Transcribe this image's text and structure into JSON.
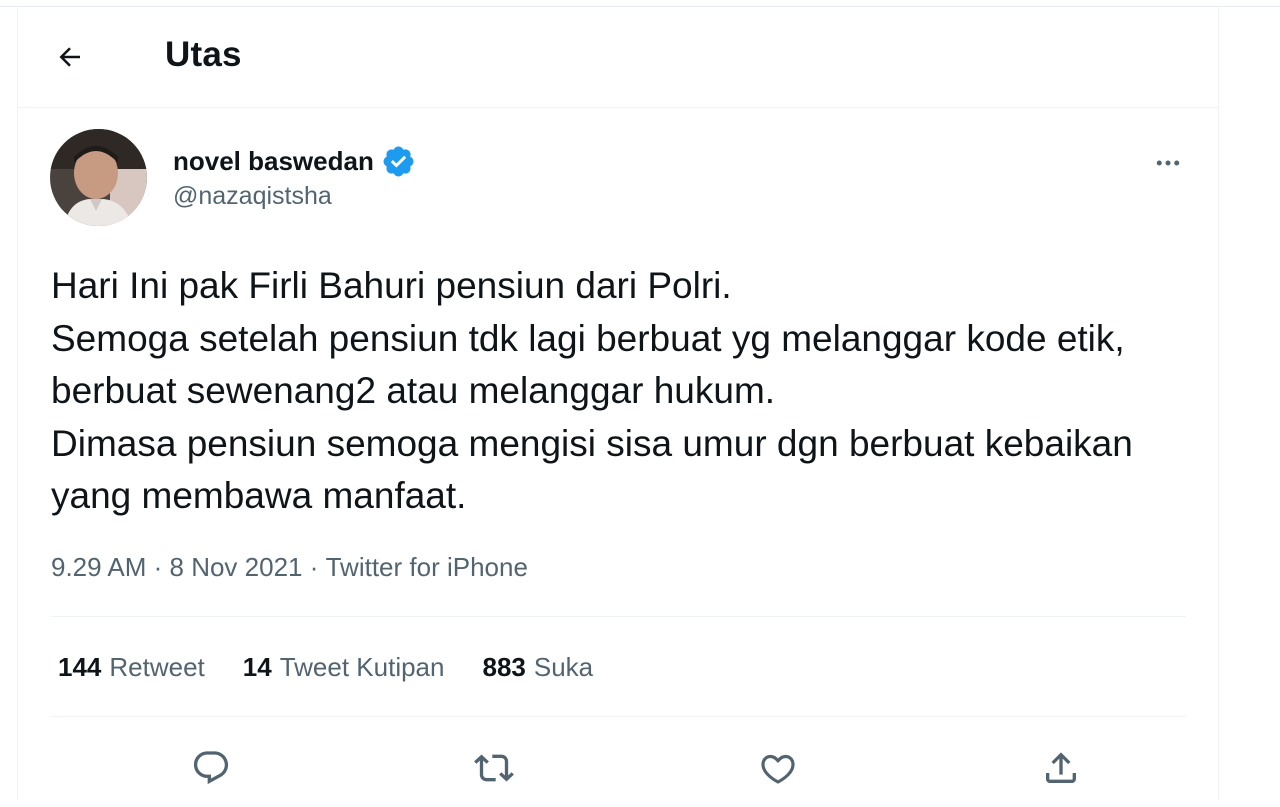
{
  "header": {
    "title": "Utas"
  },
  "tweet": {
    "author_name": "novel baswedan",
    "author_handle": "@nazaqistsha",
    "text": "Hari Ini pak Firli Bahuri pensiun dari Polri.\nSemoga setelah pensiun tdk lagi berbuat yg melanggar kode etik, berbuat sewenang2 atau melanggar hukum.\nDimasa pensiun semoga mengisi sisa umur dgn berbuat kebaikan yang membawa manfaat.",
    "time": "9.29 AM",
    "date": "8 Nov 2021",
    "separator": " · ",
    "source": "Twitter for iPhone"
  },
  "stats": {
    "retweets_count": "144",
    "retweets_label": "Retweet",
    "quotes_count": "14",
    "quotes_label": "Tweet Kutipan",
    "likes_count": "883",
    "likes_label": "Suka"
  },
  "icons": {
    "back": "arrow-left-icon",
    "verified": "verified-badge-icon",
    "more": "more-horizontal-icon",
    "reply": "reply-icon",
    "retweet": "retweet-icon",
    "like": "heart-icon",
    "share": "share-icon"
  },
  "colors": {
    "verified": "#1d9bf0",
    "secondary_text": "#536471",
    "icon": "#536471"
  }
}
